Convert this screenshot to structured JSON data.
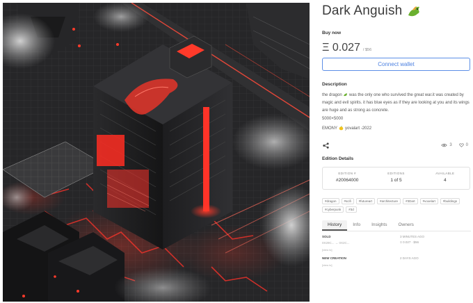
{
  "artwork": {
    "alt_icon": "artwork-image"
  },
  "title": "Dark Anguish",
  "buy_now_label": "Buy now",
  "price": "Ξ 0.027",
  "price_usd": "/ $56",
  "connect_wallet_label": "Connect wallet",
  "description_label": "Description",
  "description_text_1": "the dragon",
  "description_text_2": "was the only one who survived the great war.it was created by magic and evil spirits. it has blue eyes as if they are looking at you and its wings are huge and as strong as concrete.",
  "edition_count_text": "5000×5000",
  "author_prefix": "EMONY",
  "author_suffix": "yovalart -2022",
  "views": "3",
  "likes": "0",
  "edition_details_label": "Edition Details",
  "edition_details": [
    {
      "key": "EDITION #",
      "value": "#20064000"
    },
    {
      "key": "EDITIONS",
      "value": "1 of 5"
    },
    {
      "key": "AVAILABLE",
      "value": "4"
    }
  ],
  "tags": [
    "#dragon",
    "#scifi",
    "#futureart",
    "#architecture",
    "#3Dart",
    "#voxelart",
    "#buildings",
    "#cyberpunk",
    "#3d"
  ],
  "tabs": [
    "History",
    "Info",
    "Insights",
    "Owners"
  ],
  "history": [
    {
      "event": "SOLD",
      "sub": "0X29C... → 0X2C...",
      "link": "[view tx]",
      "when": "3 MINUTES AGO",
      "amount": "Ξ 0.027 · $56"
    },
    {
      "event": "NEW CREATION",
      "sub": "",
      "link": "[view tx]",
      "when": "2 DAYS AGO",
      "amount": ""
    }
  ],
  "colors": {
    "accent": "#4a7fe0",
    "lava": "#e8312a",
    "dragon_green": "#6ab02f"
  }
}
